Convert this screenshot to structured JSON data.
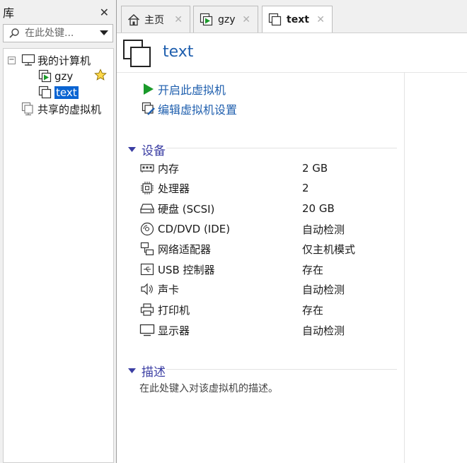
{
  "library": {
    "title": "库",
    "search_placeholder": "在此处键...",
    "tree": {
      "root_label": "我的计算机",
      "vms": [
        {
          "label": "gzy",
          "favorite": true
        },
        {
          "label": "text",
          "selected": true
        }
      ],
      "shared_label": "共享的虚拟机"
    }
  },
  "tabs": [
    {
      "label": "主页",
      "icon": "home-icon"
    },
    {
      "label": "gzy",
      "icon": "vm-running-icon"
    },
    {
      "label": "text",
      "icon": "vm-icon",
      "active": true
    }
  ],
  "vm": {
    "title": "text",
    "actions": {
      "power_on": "开启此虚拟机",
      "edit_settings": "编辑虚拟机设置"
    },
    "devices_title": "设备",
    "devices": [
      {
        "name": "内存",
        "value": "2 GB",
        "icon": "memory-icon"
      },
      {
        "name": "处理器",
        "value": "2",
        "icon": "processor-icon"
      },
      {
        "name": "硬盘 (SCSI)",
        "value": "20 GB",
        "icon": "hard-disk-icon"
      },
      {
        "name": "CD/DVD (IDE)",
        "value": "自动检测",
        "icon": "cd-dvd-icon"
      },
      {
        "name": "网络适配器",
        "value": "仅主机模式",
        "icon": "network-adapter-icon"
      },
      {
        "name": "USB 控制器",
        "value": "存在",
        "icon": "usb-icon"
      },
      {
        "name": "声卡",
        "value": "自动检测",
        "icon": "sound-icon"
      },
      {
        "name": "打印机",
        "value": "存在",
        "icon": "printer-icon"
      },
      {
        "name": "显示器",
        "value": "自动检测",
        "icon": "display-icon"
      }
    ],
    "description_title": "描述",
    "description_placeholder": "在此处键入对该虚拟机的描述。"
  },
  "colors": {
    "link": "#1f5fae",
    "section": "#3b3ea3",
    "selection": "#0a64d2",
    "play": "#1a9a2a"
  }
}
